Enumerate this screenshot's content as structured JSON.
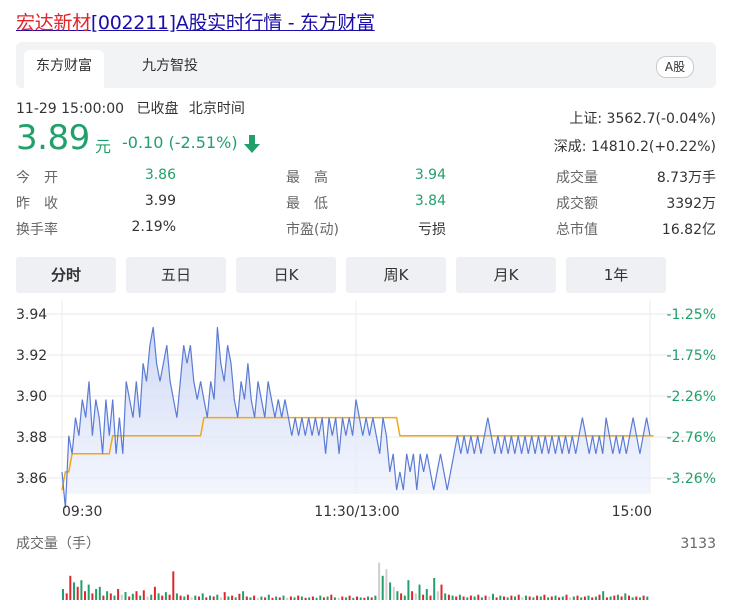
{
  "page": {
    "title_code": "宏达新材",
    "title_rest": "[002211]A股实时行情 - 东方财富"
  },
  "tabs": [
    {
      "label": "东方财富",
      "active": true
    },
    {
      "label": "九方智投",
      "active": false
    }
  ],
  "market_badge": "A股",
  "status": {
    "datetime": "11-29 15:00:00",
    "state": "已收盘",
    "timezone": "北京时间"
  },
  "quote": {
    "price": "3.89",
    "unit": "元",
    "change": "-0.10 (-2.51%)",
    "direction": "down"
  },
  "indices": {
    "sh": "上证: 3562.7(-0.04%)",
    "sz": "深成: 14810.2(+0.22%)"
  },
  "stats": {
    "open_label": "今　开",
    "open": "3.86",
    "prev_label": "昨　收",
    "prev": "3.99",
    "turnover_rate_label": "换手率",
    "turnover_rate": "2.19%",
    "high_label": "最　高",
    "high": "3.94",
    "low_label": "最　低",
    "low": "3.84",
    "pe_label": "市盈(动)",
    "pe": "亏损",
    "volume_label": "成交量",
    "volume": "8.73万手",
    "amount_label": "成交额",
    "amount": "3392万",
    "mcap_label": "总市值",
    "mcap": "16.82亿"
  },
  "periods": [
    "分时",
    "五日",
    "日K",
    "周K",
    "月K",
    "1年"
  ],
  "active_period": "分时",
  "colors": {
    "up": "#e0262c",
    "down": "#22a06b",
    "price_line": "#5b7bd5",
    "avg_line": "#f0a818"
  },
  "chart_data": {
    "type": "line",
    "price_ticks": [
      "3.94",
      "3.92",
      "3.90",
      "3.88",
      "3.86"
    ],
    "pct_ticks": [
      "-1.25%",
      "-1.75%",
      "-2.26%",
      "-2.76%",
      "-3.26%"
    ],
    "time_ticks": [
      "09:30",
      "11:30/13:00",
      "15:00"
    ],
    "ylim": [
      3.85,
      3.945
    ],
    "volume_label": "成交量（手）",
    "volume_max": "3133",
    "series": [
      {
        "values": [
          3.86,
          3.84,
          3.88,
          3.87,
          3.89,
          3.88,
          3.9,
          3.89,
          3.91,
          3.88,
          3.9,
          3.89,
          3.87,
          3.9,
          3.88,
          3.9,
          3.87,
          3.89,
          3.87,
          3.91,
          3.9,
          3.89,
          3.91,
          3.89,
          3.92,
          3.91,
          3.93,
          3.94,
          3.92,
          3.91,
          3.92,
          3.93,
          3.91,
          3.9,
          3.89,
          3.91,
          3.93,
          3.92,
          3.93,
          3.91,
          3.9,
          3.91,
          3.9,
          3.89,
          3.91,
          3.9,
          3.94,
          3.92,
          3.91,
          3.93,
          3.92,
          3.9,
          3.89,
          3.91,
          3.9,
          3.92,
          3.9,
          3.89,
          3.91,
          3.9,
          3.89,
          3.91,
          3.9,
          3.89,
          3.9,
          3.89,
          3.9,
          3.89,
          3.88,
          3.89,
          3.88,
          3.89,
          3.88,
          3.89,
          3.88,
          3.89,
          3.88,
          3.89,
          3.87,
          3.89,
          3.88,
          3.89,
          3.87,
          3.89,
          3.88,
          3.89,
          3.88,
          3.9,
          3.89,
          3.88,
          3.89,
          3.88,
          3.89,
          3.88,
          3.87,
          3.89,
          3.88,
          3.86,
          3.87,
          3.85,
          3.86,
          3.85,
          3.87,
          3.86,
          3.87,
          3.85,
          3.87,
          3.86,
          3.87,
          3.86,
          3.85,
          3.86,
          3.87,
          3.86,
          3.85,
          3.86,
          3.87,
          3.88,
          3.87,
          3.88,
          3.87,
          3.88,
          3.87,
          3.88,
          3.87,
          3.88,
          3.89,
          3.88,
          3.87,
          3.88,
          3.87,
          3.88,
          3.87,
          3.88,
          3.87,
          3.88,
          3.87,
          3.88,
          3.87,
          3.88,
          3.87,
          3.88,
          3.87,
          3.88,
          3.87,
          3.88,
          3.87,
          3.88,
          3.87,
          3.88,
          3.87,
          3.88,
          3.87,
          3.88,
          3.89,
          3.88,
          3.87,
          3.88,
          3.87,
          3.88,
          3.87,
          3.89,
          3.88,
          3.87,
          3.88,
          3.87,
          3.88,
          3.87,
          3.88,
          3.89,
          3.88,
          3.87,
          3.88,
          3.89,
          3.88
        ]
      },
      {
        "values": [
          3.85,
          3.86,
          3.86,
          3.87,
          3.87,
          3.87,
          3.87,
          3.87,
          3.87,
          3.87,
          3.87,
          3.87,
          3.87,
          3.87,
          3.87,
          3.88,
          3.88,
          3.88,
          3.88,
          3.88,
          3.88,
          3.88,
          3.88,
          3.88,
          3.88,
          3.88,
          3.88,
          3.88,
          3.88,
          3.88,
          3.88,
          3.88,
          3.88,
          3.88,
          3.88,
          3.88,
          3.88,
          3.88,
          3.88,
          3.88,
          3.88,
          3.88,
          3.89,
          3.89,
          3.89,
          3.89,
          3.89,
          3.89,
          3.89,
          3.89,
          3.89,
          3.89,
          3.89,
          3.89,
          3.89,
          3.89,
          3.89,
          3.89,
          3.89,
          3.89,
          3.89,
          3.89,
          3.89,
          3.89,
          3.89,
          3.89,
          3.89,
          3.89,
          3.89,
          3.89,
          3.89,
          3.89,
          3.89,
          3.89,
          3.89,
          3.89,
          3.89,
          3.89,
          3.89,
          3.89,
          3.89,
          3.89,
          3.89,
          3.89,
          3.89,
          3.89,
          3.89,
          3.89,
          3.89,
          3.89,
          3.89,
          3.89,
          3.89,
          3.89,
          3.89,
          3.89,
          3.89,
          3.89,
          3.89,
          3.89,
          3.88,
          3.88,
          3.88,
          3.88,
          3.88,
          3.88,
          3.88,
          3.88,
          3.88,
          3.88,
          3.88,
          3.88,
          3.88,
          3.88,
          3.88,
          3.88,
          3.88,
          3.88,
          3.88,
          3.88,
          3.88,
          3.88,
          3.88,
          3.88,
          3.88,
          3.88,
          3.88,
          3.88,
          3.88,
          3.88,
          3.88,
          3.88,
          3.88,
          3.88,
          3.88,
          3.88,
          3.88,
          3.88,
          3.88,
          3.88,
          3.88,
          3.88,
          3.88,
          3.88,
          3.88,
          3.88,
          3.88,
          3.88,
          3.88,
          3.88,
          3.88,
          3.88,
          3.88,
          3.88,
          3.88,
          3.88,
          3.88,
          3.88,
          3.88,
          3.88,
          3.88,
          3.88,
          3.88,
          3.88,
          3.88,
          3.88,
          3.88,
          3.88,
          3.88,
          3.88,
          3.88,
          3.88,
          3.88,
          3.88,
          3.88,
          3.88
        ]
      }
    ],
    "volumes": [
      {
        "v": 0.25,
        "c": "down"
      },
      {
        "v": 0.15,
        "c": "up"
      },
      {
        "v": 0.55,
        "c": "up"
      },
      {
        "v": 0.4,
        "c": "down"
      },
      {
        "v": 0.3,
        "c": "up"
      },
      {
        "v": 0.45,
        "c": "down"
      },
      {
        "v": 0.2,
        "c": "up"
      },
      {
        "v": 0.35,
        "c": "down"
      },
      {
        "v": 0.15,
        "c": "up"
      },
      {
        "v": 0.25,
        "c": "down"
      },
      {
        "v": 0.3,
        "c": "down"
      },
      {
        "v": 0.1,
        "c": "up"
      },
      {
        "v": 0.2,
        "c": "down"
      },
      {
        "v": 0.15,
        "c": "up"
      },
      {
        "v": 0.1,
        "c": "down"
      },
      {
        "v": 0.25,
        "c": "up"
      },
      {
        "v": 0.12,
        "c": "gray"
      },
      {
        "v": 0.18,
        "c": "down"
      },
      {
        "v": 0.08,
        "c": "up"
      },
      {
        "v": 0.14,
        "c": "down"
      },
      {
        "v": 0.2,
        "c": "up"
      },
      {
        "v": 0.1,
        "c": "down"
      },
      {
        "v": 0.22,
        "c": "up"
      },
      {
        "v": 0.08,
        "c": "gray"
      },
      {
        "v": 0.12,
        "c": "down"
      },
      {
        "v": 0.3,
        "c": "up"
      },
      {
        "v": 0.15,
        "c": "down"
      },
      {
        "v": 0.1,
        "c": "up"
      },
      {
        "v": 0.18,
        "c": "down"
      },
      {
        "v": 0.12,
        "c": "up"
      },
      {
        "v": 0.65,
        "c": "up"
      },
      {
        "v": 0.15,
        "c": "down"
      },
      {
        "v": 0.1,
        "c": "up"
      },
      {
        "v": 0.08,
        "c": "down"
      },
      {
        "v": 0.12,
        "c": "up"
      },
      {
        "v": 0.06,
        "c": "gray"
      },
      {
        "v": 0.1,
        "c": "down"
      },
      {
        "v": 0.08,
        "c": "up"
      },
      {
        "v": 0.15,
        "c": "down"
      },
      {
        "v": 0.06,
        "c": "up"
      },
      {
        "v": 0.1,
        "c": "down"
      },
      {
        "v": 0.08,
        "c": "up"
      },
      {
        "v": 0.12,
        "c": "down"
      },
      {
        "v": 0.06,
        "c": "gray"
      },
      {
        "v": 0.18,
        "c": "up"
      },
      {
        "v": 0.08,
        "c": "down"
      },
      {
        "v": 0.1,
        "c": "up"
      },
      {
        "v": 0.06,
        "c": "down"
      },
      {
        "v": 0.14,
        "c": "up"
      },
      {
        "v": 0.2,
        "c": "down"
      },
      {
        "v": 0.08,
        "c": "up"
      },
      {
        "v": 0.06,
        "c": "down"
      },
      {
        "v": 0.1,
        "c": "up"
      },
      {
        "v": 0.05,
        "c": "gray"
      },
      {
        "v": 0.08,
        "c": "down"
      },
      {
        "v": 0.06,
        "c": "up"
      },
      {
        "v": 0.12,
        "c": "down"
      },
      {
        "v": 0.05,
        "c": "up"
      },
      {
        "v": 0.08,
        "c": "down"
      },
      {
        "v": 0.06,
        "c": "up"
      },
      {
        "v": 0.1,
        "c": "down"
      },
      {
        "v": 0.05,
        "c": "gray"
      },
      {
        "v": 0.08,
        "c": "up"
      },
      {
        "v": 0.06,
        "c": "down"
      },
      {
        "v": 0.1,
        "c": "up"
      },
      {
        "v": 0.08,
        "c": "down"
      },
      {
        "v": 0.05,
        "c": "up"
      },
      {
        "v": 0.06,
        "c": "down"
      },
      {
        "v": 0.08,
        "c": "up"
      },
      {
        "v": 0.05,
        "c": "down"
      },
      {
        "v": 0.1,
        "c": "down"
      },
      {
        "v": 0.06,
        "c": "up"
      },
      {
        "v": 0.08,
        "c": "down"
      },
      {
        "v": 0.12,
        "c": "up"
      },
      {
        "v": 0.06,
        "c": "down"
      },
      {
        "v": 0.05,
        "c": "gray"
      },
      {
        "v": 0.08,
        "c": "up"
      },
      {
        "v": 0.06,
        "c": "down"
      },
      {
        "v": 0.1,
        "c": "up"
      },
      {
        "v": 0.05,
        "c": "down"
      },
      {
        "v": 0.08,
        "c": "up"
      },
      {
        "v": 0.06,
        "c": "down"
      },
      {
        "v": 0.05,
        "c": "up"
      },
      {
        "v": 0.08,
        "c": "down"
      },
      {
        "v": 0.06,
        "c": "up"
      },
      {
        "v": 0.1,
        "c": "down"
      },
      {
        "v": 0.85,
        "c": "gray"
      },
      {
        "v": 0.55,
        "c": "down"
      },
      {
        "v": 0.7,
        "c": "gray"
      },
      {
        "v": 0.4,
        "c": "down"
      },
      {
        "v": 0.3,
        "c": "gray"
      },
      {
        "v": 0.2,
        "c": "down"
      },
      {
        "v": 0.15,
        "c": "up"
      },
      {
        "v": 0.1,
        "c": "down"
      },
      {
        "v": 0.45,
        "c": "down"
      },
      {
        "v": 0.2,
        "c": "up"
      },
      {
        "v": 0.15,
        "c": "gray"
      },
      {
        "v": 0.35,
        "c": "down"
      },
      {
        "v": 0.12,
        "c": "up"
      },
      {
        "v": 0.25,
        "c": "down"
      },
      {
        "v": 0.1,
        "c": "up"
      },
      {
        "v": 0.5,
        "c": "down"
      },
      {
        "v": 0.2,
        "c": "gray"
      },
      {
        "v": 0.35,
        "c": "up"
      },
      {
        "v": 0.15,
        "c": "down"
      },
      {
        "v": 0.12,
        "c": "up"
      },
      {
        "v": 0.1,
        "c": "down"
      },
      {
        "v": 0.08,
        "c": "up"
      },
      {
        "v": 0.12,
        "c": "down"
      },
      {
        "v": 0.08,
        "c": "up"
      },
      {
        "v": 0.06,
        "c": "down"
      },
      {
        "v": 0.1,
        "c": "up"
      },
      {
        "v": 0.08,
        "c": "down"
      },
      {
        "v": 0.12,
        "c": "up"
      },
      {
        "v": 0.06,
        "c": "down"
      },
      {
        "v": 0.1,
        "c": "up"
      },
      {
        "v": 0.08,
        "c": "gray"
      },
      {
        "v": 0.14,
        "c": "down"
      },
      {
        "v": 0.06,
        "c": "up"
      },
      {
        "v": 0.1,
        "c": "down"
      },
      {
        "v": 0.08,
        "c": "up"
      },
      {
        "v": 0.06,
        "c": "down"
      },
      {
        "v": 0.1,
        "c": "up"
      },
      {
        "v": 0.08,
        "c": "down"
      },
      {
        "v": 0.12,
        "c": "up"
      },
      {
        "v": 0.06,
        "c": "gray"
      },
      {
        "v": 0.1,
        "c": "down"
      },
      {
        "v": 0.08,
        "c": "up"
      },
      {
        "v": 0.06,
        "c": "down"
      },
      {
        "v": 0.1,
        "c": "up"
      },
      {
        "v": 0.08,
        "c": "down"
      },
      {
        "v": 0.12,
        "c": "up"
      },
      {
        "v": 0.06,
        "c": "down"
      },
      {
        "v": 0.08,
        "c": "up"
      },
      {
        "v": 0.1,
        "c": "down"
      },
      {
        "v": 0.06,
        "c": "up"
      },
      {
        "v": 0.08,
        "c": "down"
      },
      {
        "v": 0.12,
        "c": "up"
      },
      {
        "v": 0.06,
        "c": "gray"
      },
      {
        "v": 0.08,
        "c": "down"
      },
      {
        "v": 0.1,
        "c": "up"
      },
      {
        "v": 0.06,
        "c": "down"
      },
      {
        "v": 0.08,
        "c": "up"
      },
      {
        "v": 0.1,
        "c": "down"
      },
      {
        "v": 0.06,
        "c": "up"
      },
      {
        "v": 0.08,
        "c": "down"
      },
      {
        "v": 0.12,
        "c": "up"
      },
      {
        "v": 0.2,
        "c": "down"
      },
      {
        "v": 0.06,
        "c": "up"
      },
      {
        "v": 0.08,
        "c": "down"
      },
      {
        "v": 0.1,
        "c": "up"
      },
      {
        "v": 0.12,
        "c": "down"
      },
      {
        "v": 0.08,
        "c": "up"
      },
      {
        "v": 0.15,
        "c": "down"
      },
      {
        "v": 0.1,
        "c": "up"
      },
      {
        "v": 0.06,
        "c": "down"
      },
      {
        "v": 0.08,
        "c": "up"
      },
      {
        "v": 0.06,
        "c": "down"
      },
      {
        "v": 0.1,
        "c": "up"
      },
      {
        "v": 0.08,
        "c": "down"
      }
    ]
  }
}
